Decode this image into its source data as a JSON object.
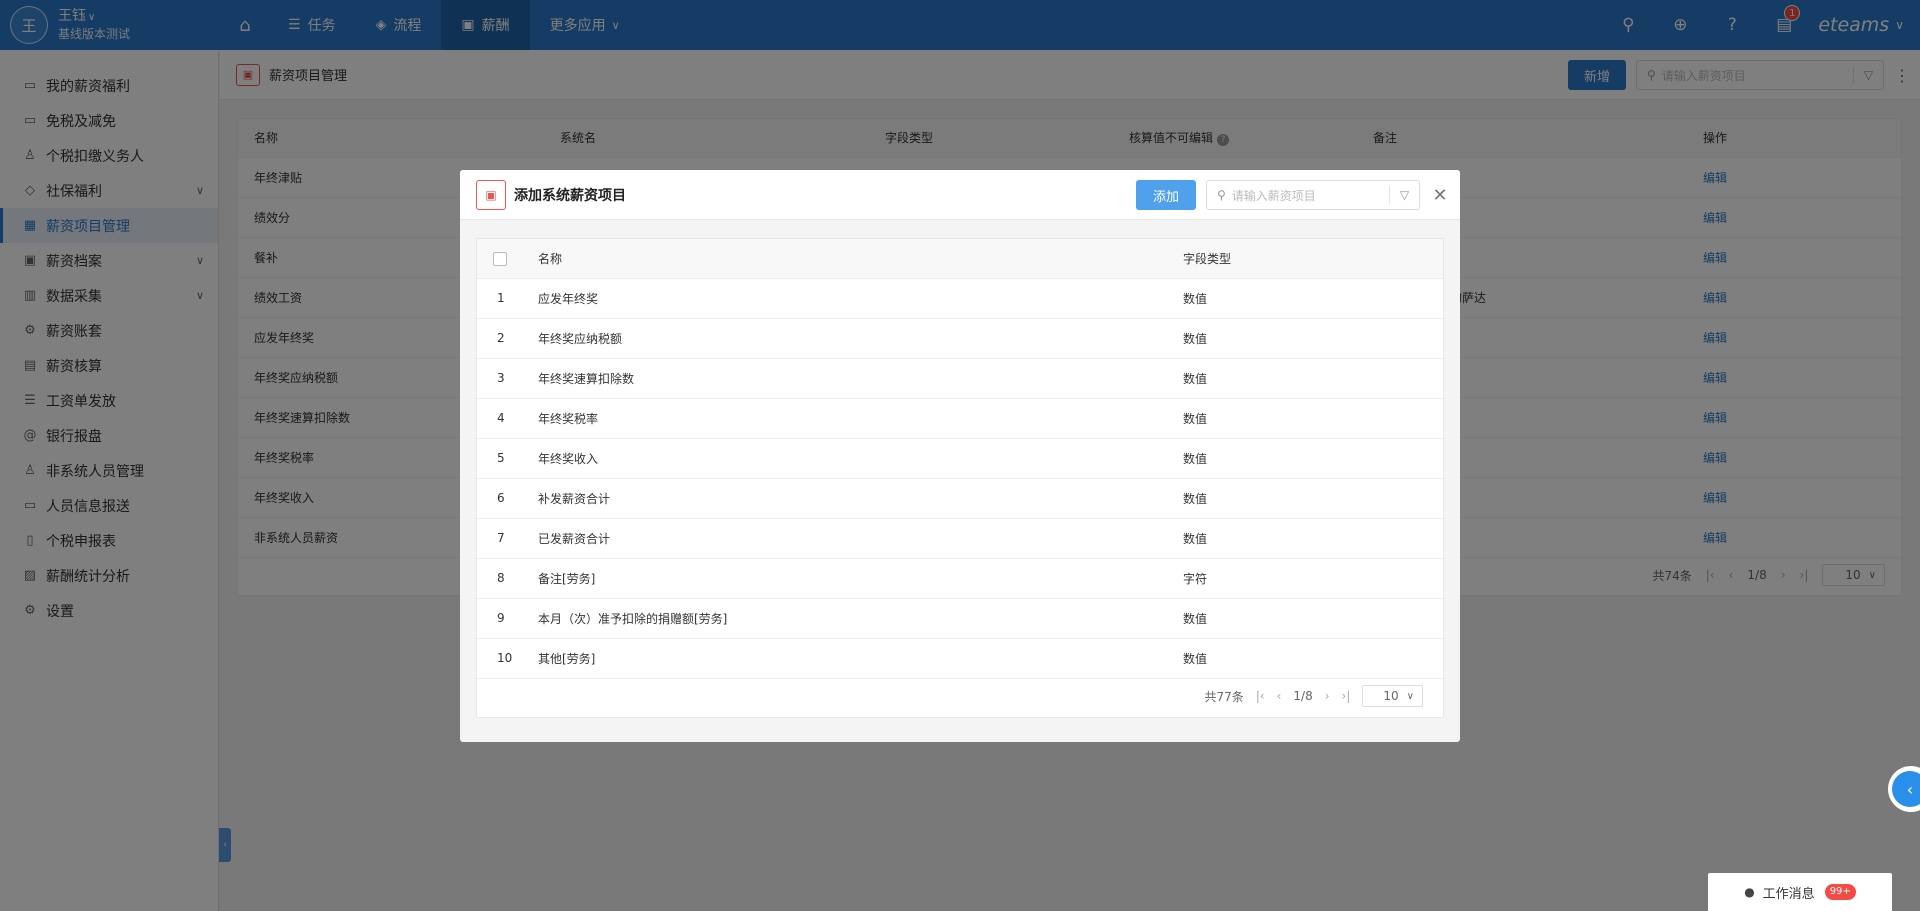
{
  "user": {
    "avatar_letter": "王",
    "name": "王钰",
    "subtitle": "基线版本测试"
  },
  "nav": {
    "items": [
      {
        "icon": "☰",
        "label": "任务"
      },
      {
        "icon": "◈",
        "label": "流程"
      },
      {
        "icon": "▣",
        "label": "薪酬"
      },
      {
        "label": "更多应用"
      }
    ]
  },
  "topbar": {
    "brand": "eteams",
    "notif_count": "1"
  },
  "sidebar": {
    "items": [
      {
        "label": "我的薪资福利"
      },
      {
        "label": "免税及减免"
      },
      {
        "label": "个税扣缴义务人"
      },
      {
        "label": "社保福利"
      },
      {
        "label": "薪资项目管理"
      },
      {
        "label": "薪资档案"
      },
      {
        "label": "数据采集"
      },
      {
        "label": "薪资账套"
      },
      {
        "label": "薪资核算"
      },
      {
        "label": "工资单发放"
      },
      {
        "label": "银行报盘"
      },
      {
        "label": "非系统人员管理"
      },
      {
        "label": "人员信息报送"
      },
      {
        "label": "个税申报表"
      },
      {
        "label": "薪酬统计分析"
      },
      {
        "label": "设置"
      }
    ]
  },
  "page": {
    "title": "薪资项目管理",
    "new_label": "新增",
    "search_placeholder": "请输入薪资项目",
    "columns": {
      "name": "名称",
      "sysname": "系统名",
      "ftype": "字段类型",
      "readonly": "核算值不可编辑",
      "remark": "备注",
      "op": "操作"
    },
    "rows": [
      {
        "name": "年终津贴",
        "op": "编辑"
      },
      {
        "name": "绩效分",
        "op": "编辑"
      },
      {
        "name": "餐补",
        "op": "编辑"
      },
      {
        "name": "绩效工资",
        "op": "编辑"
      },
      {
        "name": "应发年终奖",
        "op": "编辑"
      },
      {
        "name": "年终奖应纳税额",
        "op": "编辑"
      },
      {
        "name": "年终奖速算扣除数",
        "op": "编辑"
      },
      {
        "name": "年终奖税率",
        "op": "编辑"
      },
      {
        "name": "年终奖收入",
        "op": "编辑"
      },
      {
        "name": "非系统人员薪资",
        "op": "编辑"
      }
    ],
    "remark_fragment": "的萨达",
    "pager": {
      "total": "共74条",
      "page": "1/8",
      "size": "10"
    }
  },
  "modal": {
    "title": "添加系统薪资项目",
    "add_label": "添加",
    "search_placeholder": "请输入薪资项目",
    "columns": {
      "name": "名称",
      "ftype": "字段类型"
    },
    "rows": [
      {
        "idx": "1",
        "name": "应发年终奖",
        "ftype": "数值"
      },
      {
        "idx": "2",
        "name": "年终奖应纳税额",
        "ftype": "数值"
      },
      {
        "idx": "3",
        "name": "年终奖速算扣除数",
        "ftype": "数值"
      },
      {
        "idx": "4",
        "name": "年终奖税率",
        "ftype": "数值"
      },
      {
        "idx": "5",
        "name": "年终奖收入",
        "ftype": "数值"
      },
      {
        "idx": "6",
        "name": "补发薪资合计",
        "ftype": "数值"
      },
      {
        "idx": "7",
        "name": "已发薪资合计",
        "ftype": "数值"
      },
      {
        "idx": "8",
        "name": "备注[劳务]",
        "ftype": "字符"
      },
      {
        "idx": "9",
        "name": "本月（次）准予扣除的捐赠额[劳务]",
        "ftype": "数值"
      },
      {
        "idx": "10",
        "name": "其他[劳务]",
        "ftype": "数值"
      }
    ],
    "pager": {
      "total": "共77条",
      "page": "1/8",
      "size": "10"
    }
  },
  "messages": {
    "label": "工作消息",
    "count": "99+"
  }
}
